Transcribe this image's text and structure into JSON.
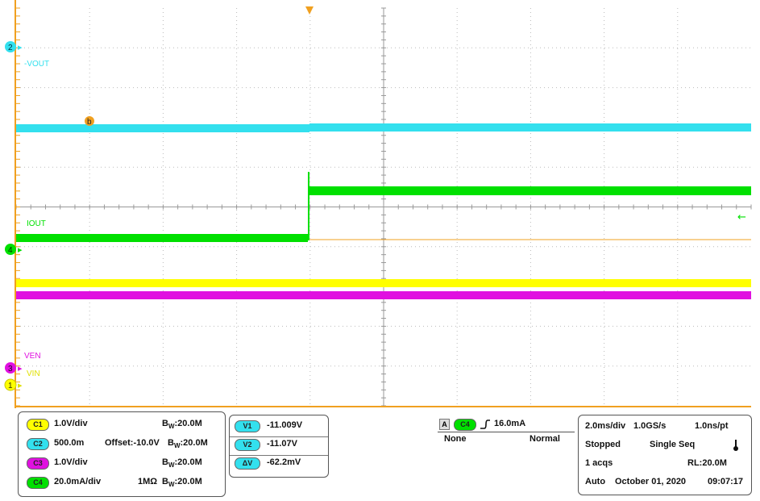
{
  "colors": {
    "ch1": "#ffff00",
    "ch2": "#33e0ee",
    "ch3": "#e010e0",
    "ch4": "#00e000",
    "ref": "#f0a020",
    "grid": "#bcbcbc"
  },
  "waveform_labels": {
    "ch2_num": "2",
    "ch2_name": "-VOUT",
    "ch4_num": "4",
    "ch4_name": "IOUT",
    "ch3_num": "3",
    "ch3_name": "VEN",
    "ch1_num": "1",
    "ch1_name": "VIN",
    "b_marker": "b",
    "trigger_arrow": "←"
  },
  "channels": [
    {
      "tag": "C1",
      "scale": "1.0V/div",
      "bw_label": "W",
      "bw_value": ":20.0M",
      "extra": ""
    },
    {
      "tag": "C2",
      "scale": "500.0m",
      "bw_label": "W",
      "bw_value": ":20.0M",
      "extra": "Offset:-10.0V"
    },
    {
      "tag": "C3",
      "scale": "1.0V/div",
      "bw_label": "W",
      "bw_value": ":20.0M",
      "extra": ""
    },
    {
      "tag": "C4",
      "scale": "20.0mA/div",
      "bw_label": "W",
      "bw_value": ":20.0M",
      "extra": "1MΩ"
    }
  ],
  "bw_prefix": "B",
  "cursors": [
    {
      "tag": "V1",
      "value": "-11.009V"
    },
    {
      "tag": "V2",
      "value": "-11.07V"
    },
    {
      "tag": "ΔV",
      "value": "-62.2mV"
    }
  ],
  "trigger": {
    "a_tag": "A",
    "channel": "C4",
    "slope_icon": "rising-edge-icon",
    "level": "16.0mA",
    "coupling": "None",
    "mode": "Normal"
  },
  "acquisition": {
    "timebase": "2.0ms/div",
    "sample_rate": "1.0GS/s",
    "resolution": "1.0ns/pt",
    "state": "Stopped",
    "seq_mode": "Single Seq",
    "acqs": "1 acqs",
    "record_length": "RL:20.0M",
    "trigger_mode": "Auto",
    "date": "October 01, 2020",
    "time": "09:07:17"
  }
}
